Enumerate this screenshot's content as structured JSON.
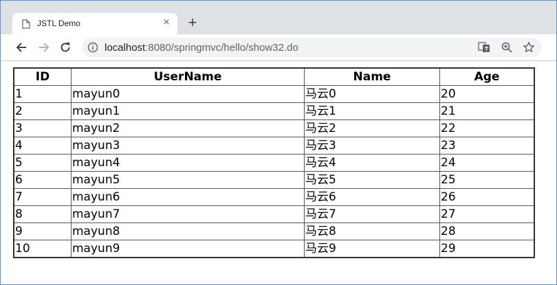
{
  "browser": {
    "tab": {
      "title": "JSTL Demo",
      "close": "×"
    },
    "new_tab": "+",
    "address": {
      "host": "localhost",
      "path": ":8080/springmvc/hello/show32.do"
    }
  },
  "table": {
    "headers": [
      "ID",
      "UserName",
      "Name",
      "Age"
    ],
    "rows": [
      [
        "1",
        "mayun0",
        "马云0",
        "20"
      ],
      [
        "2",
        "mayun1",
        "马云1",
        "21"
      ],
      [
        "3",
        "mayun2",
        "马云2",
        "22"
      ],
      [
        "4",
        "mayun3",
        "马云3",
        "23"
      ],
      [
        "5",
        "mayun4",
        "马云4",
        "24"
      ],
      [
        "6",
        "mayun5",
        "马云5",
        "25"
      ],
      [
        "7",
        "mayun6",
        "马云6",
        "26"
      ],
      [
        "8",
        "mayun7",
        "马云7",
        "27"
      ],
      [
        "9",
        "mayun8",
        "马云8",
        "28"
      ],
      [
        "10",
        "mayun9",
        "马云9",
        "29"
      ]
    ]
  }
}
